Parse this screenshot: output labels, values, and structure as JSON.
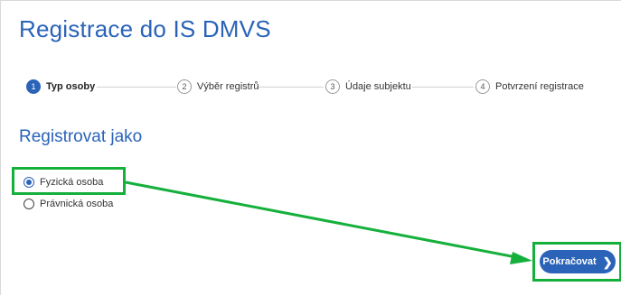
{
  "page": {
    "title": "Registrace do IS DMVS",
    "subtitle": "Registrovat jako"
  },
  "stepper": {
    "steps": [
      {
        "number": "1",
        "label": "Typ osoby",
        "active": true
      },
      {
        "number": "2",
        "label": "Výběr registrů",
        "active": false
      },
      {
        "number": "3",
        "label": "Údaje subjektu",
        "active": false
      },
      {
        "number": "4",
        "label": "Potvrzení registrace",
        "active": false
      }
    ]
  },
  "form": {
    "options": [
      {
        "label": "Fyzická osoba",
        "checked": true
      },
      {
        "label": "Právnická osoba",
        "checked": false
      }
    ],
    "continue_label": "Pokračovat",
    "continue_icon": "chevron-right-icon"
  },
  "colors": {
    "accent": "#2a63b8",
    "annotation": "#15b03c"
  }
}
